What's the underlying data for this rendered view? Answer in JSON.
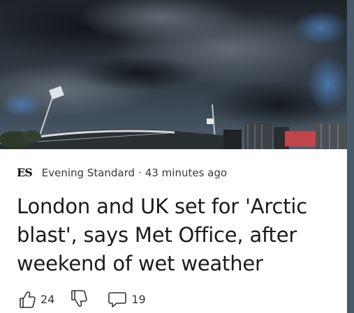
{
  "article": {
    "source_logo": "ES",
    "source_name": "Evening Standard",
    "separator": "·",
    "age": "43 minutes ago",
    "headline": "London and UK set for 'Arctic blast', says Met Office, after weekend of wet weather"
  },
  "actions": {
    "like_count": "24",
    "comment_count": "19"
  },
  "icons": {
    "like": "thumbs-up-icon",
    "dislike": "thumbs-down-icon",
    "comment": "comment-icon"
  },
  "colors": {
    "right_edge": "#465a69",
    "headline_text": "#1b1b1b"
  }
}
